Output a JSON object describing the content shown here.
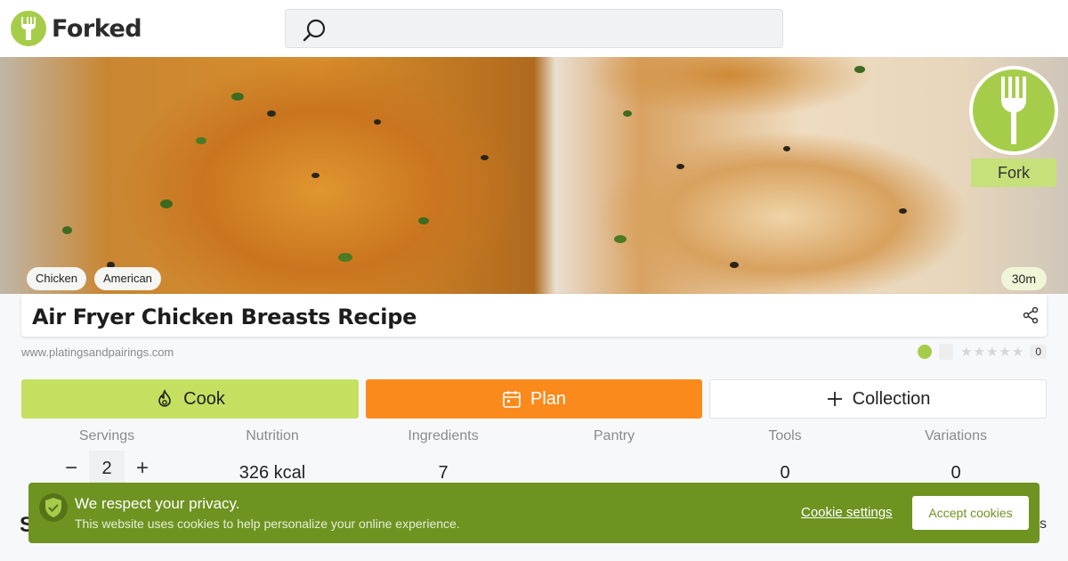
{
  "header": {
    "brand": "Forked",
    "search": {
      "placeholder": "",
      "icon": "search-icon"
    }
  },
  "hero": {
    "tags": [
      "Chicken",
      "American"
    ],
    "time": "30m",
    "fork_badge_label": "Fork"
  },
  "recipe": {
    "title": "Air Fryer Chicken Breasts Recipe",
    "source": "www.platingsandpairings.com",
    "rating_count": "0"
  },
  "actions": {
    "cook": "Cook",
    "plan": "Plan",
    "collection": "Collection"
  },
  "stats": {
    "servings": {
      "label": "Servings",
      "value": "2"
    },
    "nutrition": {
      "label": "Nutrition",
      "value": "326 kcal"
    },
    "ingredients": {
      "label": "Ingredients",
      "value": "7"
    },
    "pantry": {
      "label": "Pantry",
      "value": ""
    },
    "tools": {
      "label": "Tools",
      "value": "0"
    },
    "variations": {
      "label": "Variations",
      "value": "0"
    }
  },
  "cookie_banner": {
    "title": "We respect your privacy.",
    "text": "This website uses cookies to help personalize your online experience.",
    "settings": "Cookie settings",
    "accept": "Accept cookies"
  },
  "colors": {
    "brand_green": "#a6cd4a",
    "cook_green": "#c5e060",
    "plan_orange": "#fb8a1c",
    "cookie_green": "#6e9321"
  }
}
